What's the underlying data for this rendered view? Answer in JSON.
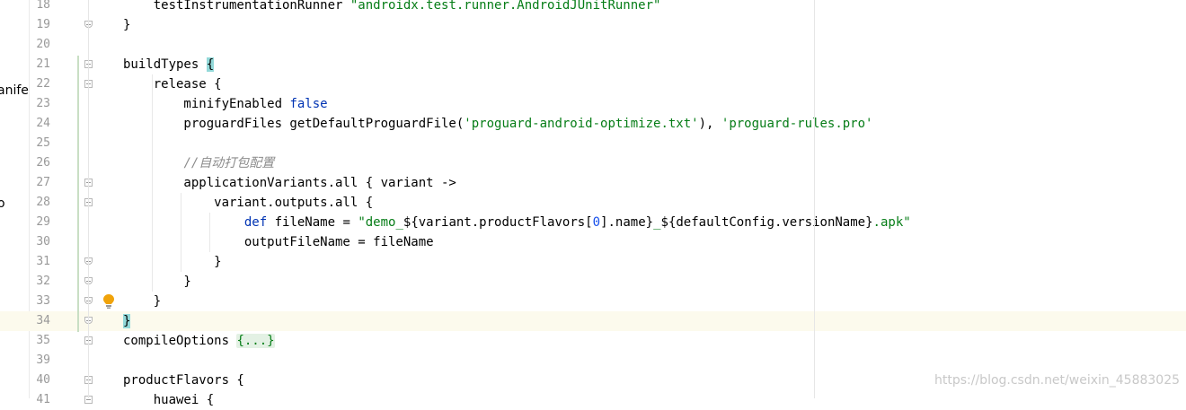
{
  "sidebar": {
    "fragments": [
      "anife",
      "o"
    ]
  },
  "editor": {
    "lines": [
      {
        "num": "18",
        "parts": [
          {
            "t": "    testInstrumentationRunner ",
            "c": ""
          },
          {
            "t": "\"androidx.test.runner.AndroidJUnitRunner\"",
            "c": "str"
          }
        ]
      },
      {
        "num": "19",
        "parts": [
          {
            "t": "}",
            "c": ""
          }
        ]
      },
      {
        "num": "20",
        "parts": []
      },
      {
        "num": "21",
        "parts": [
          {
            "t": "buildTypes ",
            "c": ""
          },
          {
            "t": "{",
            "c": "brace-hl"
          }
        ]
      },
      {
        "num": "22",
        "parts": [
          {
            "t": "    release {",
            "c": ""
          }
        ]
      },
      {
        "num": "23",
        "parts": [
          {
            "t": "        minifyEnabled ",
            "c": ""
          },
          {
            "t": "false",
            "c": "kw"
          }
        ]
      },
      {
        "num": "24",
        "parts": [
          {
            "t": "        proguardFiles getDefaultProguardFile(",
            "c": ""
          },
          {
            "t": "'proguard-android-optimize.txt'",
            "c": "str"
          },
          {
            "t": "), ",
            "c": ""
          },
          {
            "t": "'proguard-rules.pro'",
            "c": "str"
          }
        ]
      },
      {
        "num": "25",
        "parts": []
      },
      {
        "num": "26",
        "parts": [
          {
            "t": "        ",
            "c": ""
          },
          {
            "t": "//自动打包配置",
            "c": "cmt"
          }
        ]
      },
      {
        "num": "27",
        "parts": [
          {
            "t": "        applicationVariants.all { variant ->",
            "c": ""
          }
        ]
      },
      {
        "num": "28",
        "parts": [
          {
            "t": "            variant.outputs.all {",
            "c": ""
          }
        ]
      },
      {
        "num": "29",
        "parts": [
          {
            "t": "                ",
            "c": ""
          },
          {
            "t": "def",
            "c": "kw"
          },
          {
            "t": " fileName = ",
            "c": ""
          },
          {
            "t": "\"demo_",
            "c": "str"
          },
          {
            "t": "${",
            "c": ""
          },
          {
            "t": "variant.productFlavors[",
            "c": ""
          },
          {
            "t": "0",
            "c": "num-lit"
          },
          {
            "t": "].name",
            "c": ""
          },
          {
            "t": "}",
            "c": ""
          },
          {
            "t": "_",
            "c": "str"
          },
          {
            "t": "${",
            "c": ""
          },
          {
            "t": "defaultConfig.versionName",
            "c": ""
          },
          {
            "t": "}",
            "c": ""
          },
          {
            "t": ".apk\"",
            "c": "str"
          }
        ]
      },
      {
        "num": "30",
        "parts": [
          {
            "t": "                outputFileName = fileName",
            "c": ""
          }
        ]
      },
      {
        "num": "31",
        "parts": [
          {
            "t": "            }",
            "c": ""
          }
        ]
      },
      {
        "num": "32",
        "parts": [
          {
            "t": "        }",
            "c": ""
          }
        ]
      },
      {
        "num": "33",
        "parts": [
          {
            "t": "    }",
            "c": ""
          }
        ]
      },
      {
        "num": "34",
        "parts": [
          {
            "t": "}",
            "c": "brace-hl"
          }
        ]
      },
      {
        "num": "35",
        "parts": [
          {
            "t": "compileOptions ",
            "c": ""
          },
          {
            "t": "{...}",
            "c": "fold-placeholder"
          }
        ]
      },
      {
        "num": "39",
        "parts": []
      },
      {
        "num": "40",
        "parts": [
          {
            "t": "productFlavors {",
            "c": ""
          }
        ]
      },
      {
        "num": "41",
        "parts": [
          {
            "t": "    huawei {",
            "c": ""
          }
        ]
      }
    ],
    "folds": {
      "19": "end",
      "21": "start",
      "22": "start",
      "27": "start",
      "28": "start",
      "31": "end",
      "32": "end",
      "33": "end",
      "34": "end",
      "35": "plus",
      "40": "start",
      "41": "start"
    },
    "current_line": "34",
    "bulb_icon": "lightbulb-icon",
    "bulb_color": "#f0a30a"
  },
  "watermark": "https://blog.csdn.net/weixin_45883025"
}
